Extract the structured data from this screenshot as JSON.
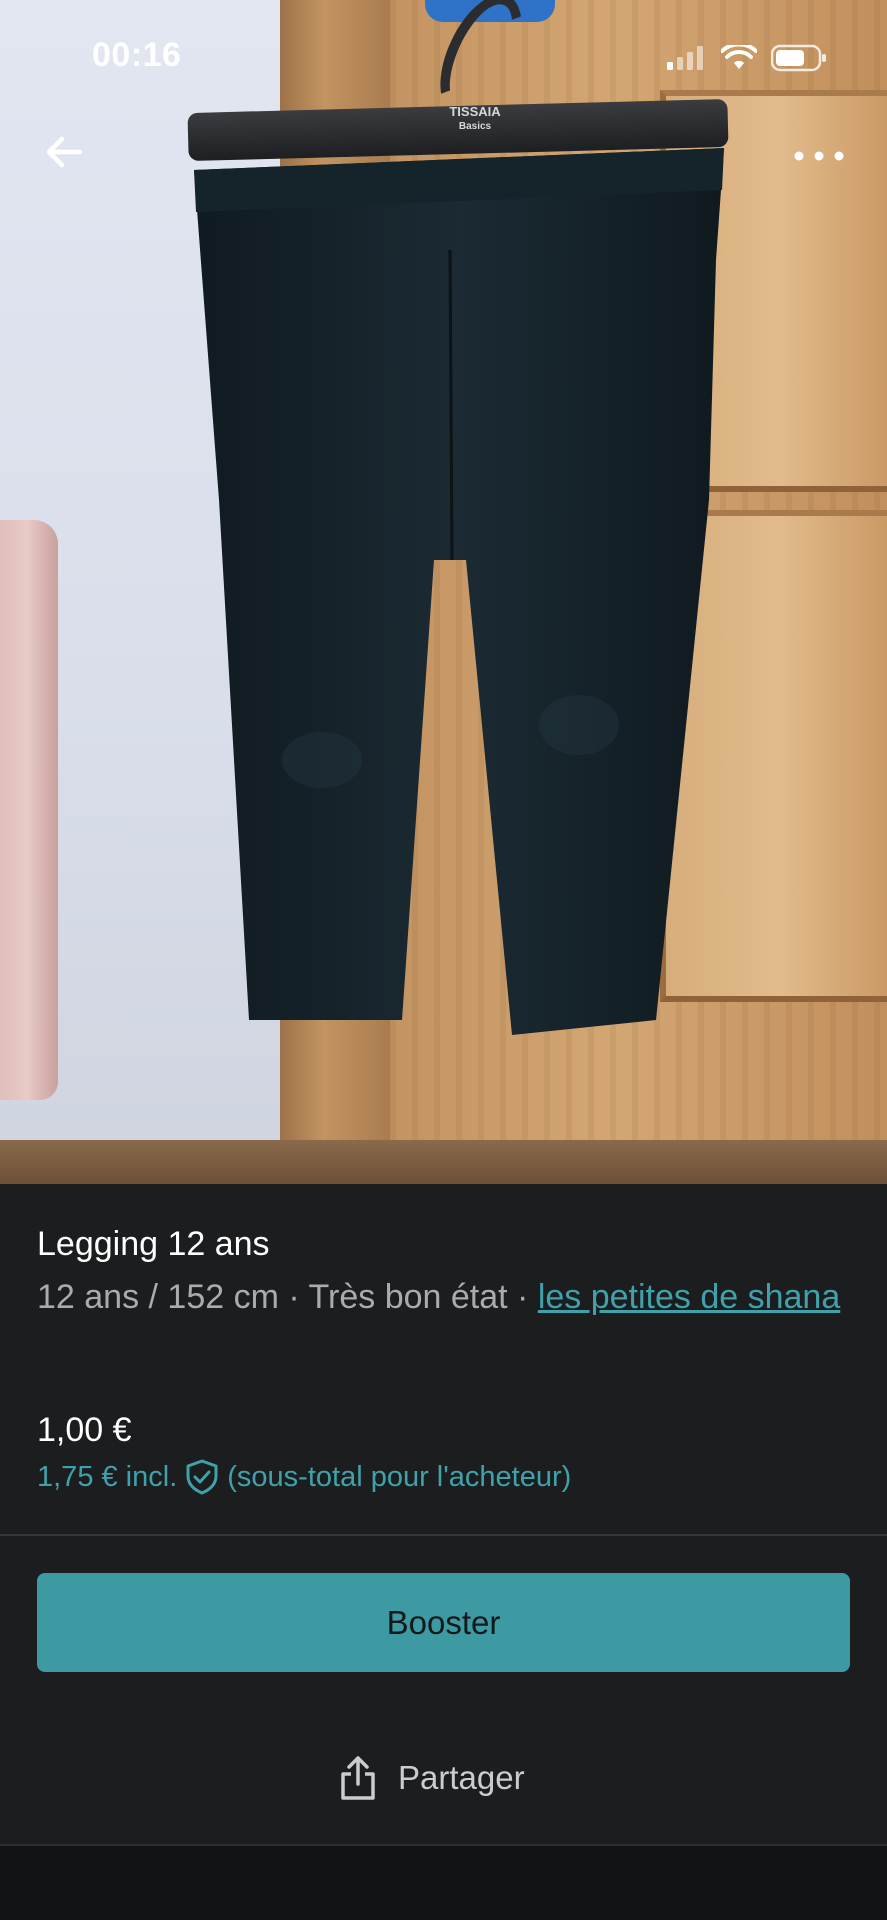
{
  "status_bar": {
    "time": "00:16",
    "icons": [
      "signal-icon",
      "wifi-icon",
      "battery-icon"
    ]
  },
  "top_controls": {
    "icons": [
      "back-arrow-icon",
      "more-options-icon"
    ]
  },
  "photo": {
    "hanger_brand_line1": "TISSAIA",
    "hanger_brand_line2": "Basics"
  },
  "item": {
    "title": "Legging 12 ans",
    "details": "12 ans / 152 cm · Très bon état · ",
    "seller": "les petites de shana",
    "price": "1,00 €",
    "price_incl_amount": "1,75 € incl.",
    "price_incl_note": "(sous-total pour l'acheteur)"
  },
  "actions": {
    "booster_label": "Booster",
    "share_label": "Partager"
  },
  "colors": {
    "accent": "#3d9aa3",
    "link": "#3fa2aa",
    "background": "#1b1d1f"
  }
}
